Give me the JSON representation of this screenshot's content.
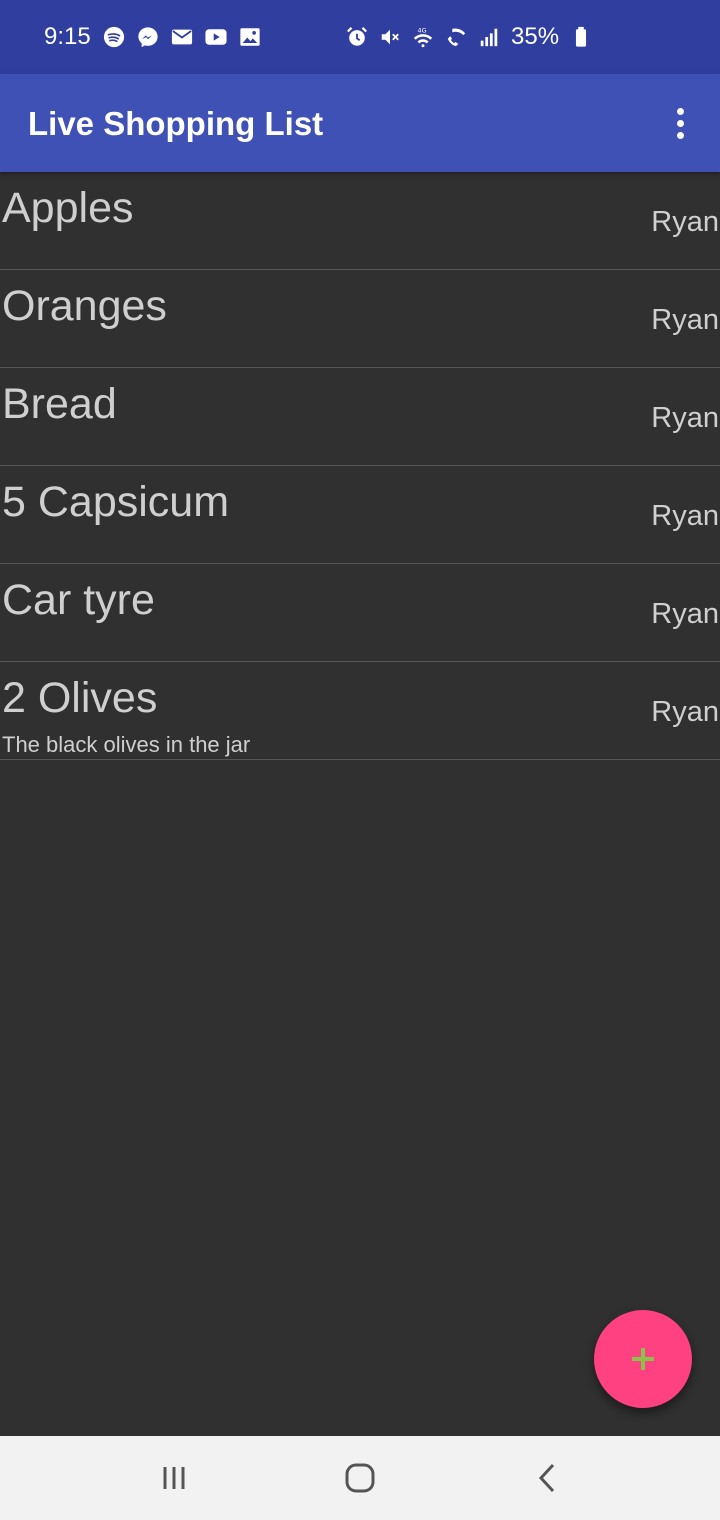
{
  "status_bar": {
    "time": "9:15",
    "battery": "35%",
    "left_icons": [
      "spotify-icon",
      "messenger-icon",
      "mail-icon",
      "youtube-icon",
      "gallery-icon"
    ],
    "right_icons": [
      "alarm-icon",
      "mute-icon",
      "wifi-4g-icon",
      "wifi-calling-icon",
      "signal-icon",
      "battery-icon"
    ]
  },
  "app_bar": {
    "title": "Live Shopping List",
    "menu_icon": "more-vert-icon"
  },
  "items": [
    {
      "name": "Apples",
      "author": "Ryan",
      "note": ""
    },
    {
      "name": "Oranges",
      "author": "Ryan",
      "note": ""
    },
    {
      "name": "Bread",
      "author": "Ryan",
      "note": ""
    },
    {
      "name": "5 Capsicum",
      "author": "Ryan",
      "note": ""
    },
    {
      "name": "Car tyre",
      "author": "Ryan",
      "note": ""
    },
    {
      "name": "2 Olives",
      "author": "Ryan",
      "note": "The black olives in the jar"
    }
  ],
  "fab": {
    "icon": "plus-icon"
  },
  "nav_bar": {
    "buttons": [
      "recents-icon",
      "home-icon",
      "back-icon"
    ]
  },
  "colors": {
    "status_bar": "#303f9f",
    "app_bar": "#3f51b5",
    "background": "#303030",
    "fab": "#ff4081",
    "fab_icon": "#8bc34a"
  }
}
